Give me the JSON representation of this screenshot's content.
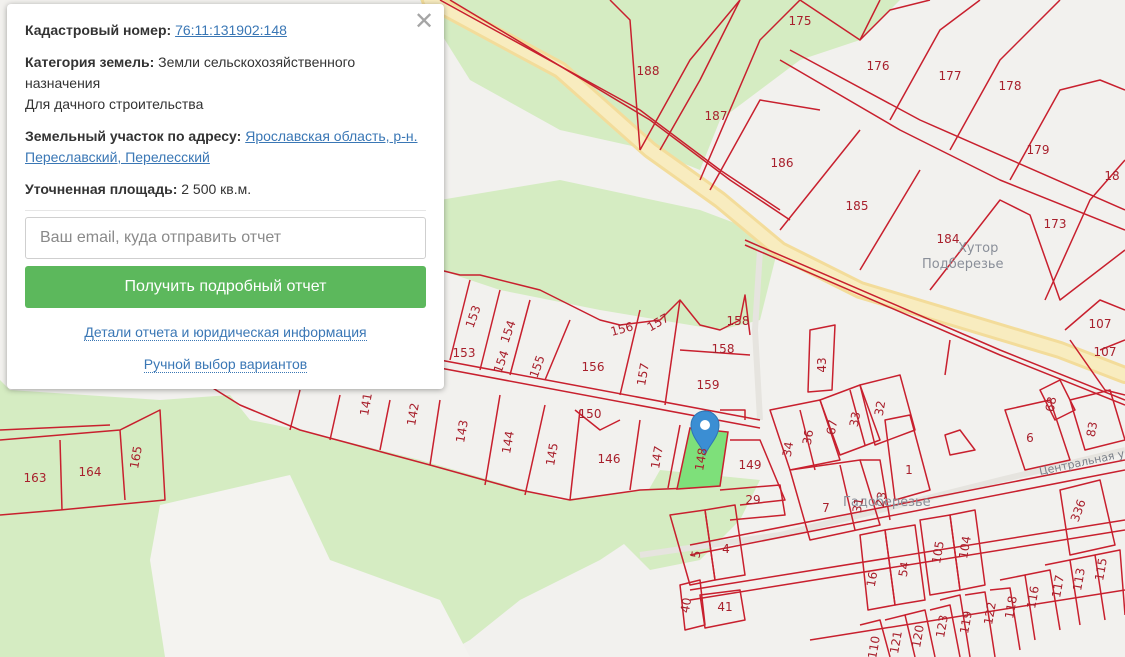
{
  "popup": {
    "cadastral_label": "Кадастровый номер:",
    "cadastral_value": "76:11:131902:148",
    "category_label": "Категория земель:",
    "category_value": "Земли сельскохозяйственного назначения",
    "usage": "Для дачного строительства",
    "address_label": "Земельный участок по адресу:",
    "address_value": "Ярославская область, р-н. Переславский, Перелесский",
    "area_label": "Уточненная площадь:",
    "area_value": "2 500 кв.м.",
    "email_placeholder": "Ваш email, куда отправить отчет",
    "report_button": "Получить подробный отчет",
    "details_link": "Детали отчета и юридическая информация",
    "manual_link": "Ручной выбор вариантов",
    "close_symbol": "✕"
  },
  "map": {
    "colors": {
      "background": "#f2f1ee",
      "forest": "#d5ecc2",
      "road": "#f6e6a6",
      "parcel_line": "#c8202e",
      "parcel_label": "#a8202c",
      "selected_parcel": "#7ee07a",
      "marker": "#3b8ed3"
    },
    "place_labels": [
      "Хутор",
      "Подберезье",
      "Гадоберезье"
    ],
    "street_label": "Центральная ул",
    "marker_icon": "map-pin-icon",
    "selected_plot": "148",
    "plot_labels": [
      "188",
      "175",
      "176",
      "177",
      "178",
      "187",
      "186",
      "179",
      "18",
      "185",
      "184",
      "173",
      "107",
      "107",
      "153",
      "154",
      "156",
      "157",
      "158",
      "153",
      "154",
      "155",
      "156",
      "157",
      "158",
      "159",
      "43",
      "141",
      "142",
      "143",
      "144",
      "145",
      "146",
      "147",
      "150",
      "148",
      "149",
      "34",
      "36",
      "67",
      "33",
      "32",
      "68",
      "83",
      "6",
      "1",
      "163",
      "164",
      "165",
      "29",
      "7",
      "31",
      "23",
      "336",
      "5",
      "4",
      "105",
      "104",
      "16",
      "54",
      "40",
      "41",
      "115",
      "113",
      "117",
      "116",
      "118",
      "122",
      "119",
      "123",
      "120",
      "121",
      "110"
    ]
  }
}
